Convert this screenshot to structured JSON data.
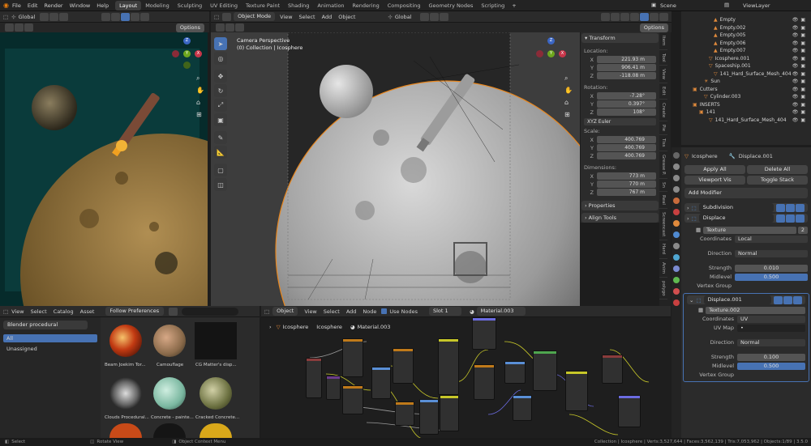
{
  "top_menu": [
    "File",
    "Edit",
    "Render",
    "Window",
    "Help"
  ],
  "workspaces": [
    {
      "label": "Layout",
      "active": true
    },
    {
      "label": "Modeling"
    },
    {
      "label": "Sculpting"
    },
    {
      "label": "UV Editing"
    },
    {
      "label": "Texture Paint"
    },
    {
      "label": "Shading"
    },
    {
      "label": "Animation"
    },
    {
      "label": "Rendering"
    },
    {
      "label": "Compositing"
    },
    {
      "label": "Geometry Nodes"
    },
    {
      "label": "Scripting"
    }
  ],
  "scene": {
    "label": "Scene",
    "view_layer": "ViewLayer"
  },
  "left_viewport": {
    "orientation": "Global",
    "options": "Options"
  },
  "main_viewport": {
    "mode": "Object Mode",
    "menus": [
      "View",
      "Select",
      "Add",
      "Object"
    ],
    "orientation": "Global",
    "options": "Options",
    "camera_title": "Camera Perspective",
    "collection_info": "(0) Collection | Icosphere"
  },
  "n_panel": {
    "transform": "Transform",
    "location": "Location:",
    "loc": [
      {
        "k": "X",
        "v": "221.93 m"
      },
      {
        "k": "Y",
        "v": "906.41 m"
      },
      {
        "k": "Z",
        "v": "-118.08 m"
      }
    ],
    "rotation": "Rotation:",
    "rot": [
      {
        "k": "X",
        "v": "-7.28°"
      },
      {
        "k": "Y",
        "v": "0.397°"
      },
      {
        "k": "Z",
        "v": "108°"
      }
    ],
    "rot_mode": "XYZ Euler",
    "scale": "Scale:",
    "scl": [
      {
        "k": "X",
        "v": "400.769"
      },
      {
        "k": "Y",
        "v": "400.769"
      },
      {
        "k": "Z",
        "v": "400.769"
      }
    ],
    "dimensions": "Dimensions:",
    "dim": [
      {
        "k": "X",
        "v": "773 m"
      },
      {
        "k": "Y",
        "v": "770 m"
      },
      {
        "k": "Z",
        "v": "767 m"
      }
    ],
    "properties": "Properties",
    "align_tools": "Align Tools"
  },
  "side_tabs": [
    "Item",
    "Tool",
    "View",
    "Edit",
    "Create",
    "Pie",
    "Tiss",
    "Grease P.",
    "Sn",
    "Real",
    "Screencast",
    "Hard",
    "Anim",
    "polygo"
  ],
  "outliner": [
    {
      "label": "Empty",
      "indent": 40,
      "icon": "▲"
    },
    {
      "label": "Empty.002",
      "indent": 40,
      "icon": "▲"
    },
    {
      "label": "Empty.005",
      "indent": 40,
      "icon": "▲"
    },
    {
      "label": "Empty.006",
      "indent": 40,
      "icon": "▲"
    },
    {
      "label": "Empty.007",
      "indent": 40,
      "icon": "▲"
    },
    {
      "label": "Icosphere.001",
      "indent": 34,
      "icon": "▽"
    },
    {
      "label": "Spaceship.001",
      "indent": 34,
      "icon": "▽"
    },
    {
      "label": "141_Hard_Surface_Mesh_404",
      "indent": 40,
      "icon": "▽"
    },
    {
      "label": "Sun",
      "indent": 28,
      "icon": "☀"
    },
    {
      "label": "Cutters",
      "indent": 14,
      "icon": "▣"
    },
    {
      "label": "Cylinder.003",
      "indent": 28,
      "icon": "▽"
    },
    {
      "label": "INSERTS",
      "indent": 14,
      "icon": "▣"
    },
    {
      "label": "141",
      "indent": 22,
      "icon": "▣"
    },
    {
      "label": "141_Hard_Surface_Mesh_404",
      "indent": 34,
      "icon": "▽"
    }
  ],
  "properties": {
    "object": "Icosphere",
    "modifier_ref": "Displace.001",
    "apply_all": "Apply All",
    "delete_all": "Delete All",
    "viewport_vis": "Viewport Vis",
    "toggle_stack": "Toggle Stack",
    "add_modifier": "Add Modifier",
    "subdivision": "Subdivision",
    "displace": "Displace",
    "texture": "Texture",
    "texture_users": "2",
    "coordinates_label": "Coordinates",
    "coordinates": "Local",
    "direction_label": "Direction",
    "direction": "Normal",
    "strength_label": "Strength",
    "strength": "0.010",
    "midlevel_label": "Midlevel",
    "midlevel": "0.500",
    "vgroup_label": "Vertex Group",
    "displace2": "Displace.001",
    "texture2": "Texture.002",
    "coordinates2": "UV",
    "uvmap_label": "UV Map",
    "uvmap": "•",
    "direction2": "Normal",
    "strength2": "0.100",
    "midlevel2": "0.500"
  },
  "asset_browser": {
    "menus": [
      "View",
      "Select",
      "Catalog",
      "Asset"
    ],
    "import": "Follow Preferences",
    "library": "Blender procedural",
    "catalog_all": "All",
    "unassigned": "Unassigned",
    "items": [
      "Beam Joekim Tor...",
      "Camouflage",
      "CG Matter's disp...",
      "Clouds Procedural...",
      "Concrete - painte...",
      "Cracked Concrete..."
    ]
  },
  "node_editor": {
    "object": "Object",
    "menus": [
      "View",
      "Select",
      "Add",
      "Node"
    ],
    "use_nodes": "Use Nodes",
    "slot": "Slot 1",
    "material": "Material.003",
    "breadcrumb": [
      "Icosphere",
      "Icosphere",
      "Material.003"
    ]
  },
  "status": {
    "select": "Select",
    "rotate": "Rotate View",
    "context": "Object Context Menu",
    "stats": "Collection | Icosphere | Verts:3,527,644 | Faces:3,562,139 | Tris:7,053,962 | Objects:1/89 | 3.5.0"
  }
}
